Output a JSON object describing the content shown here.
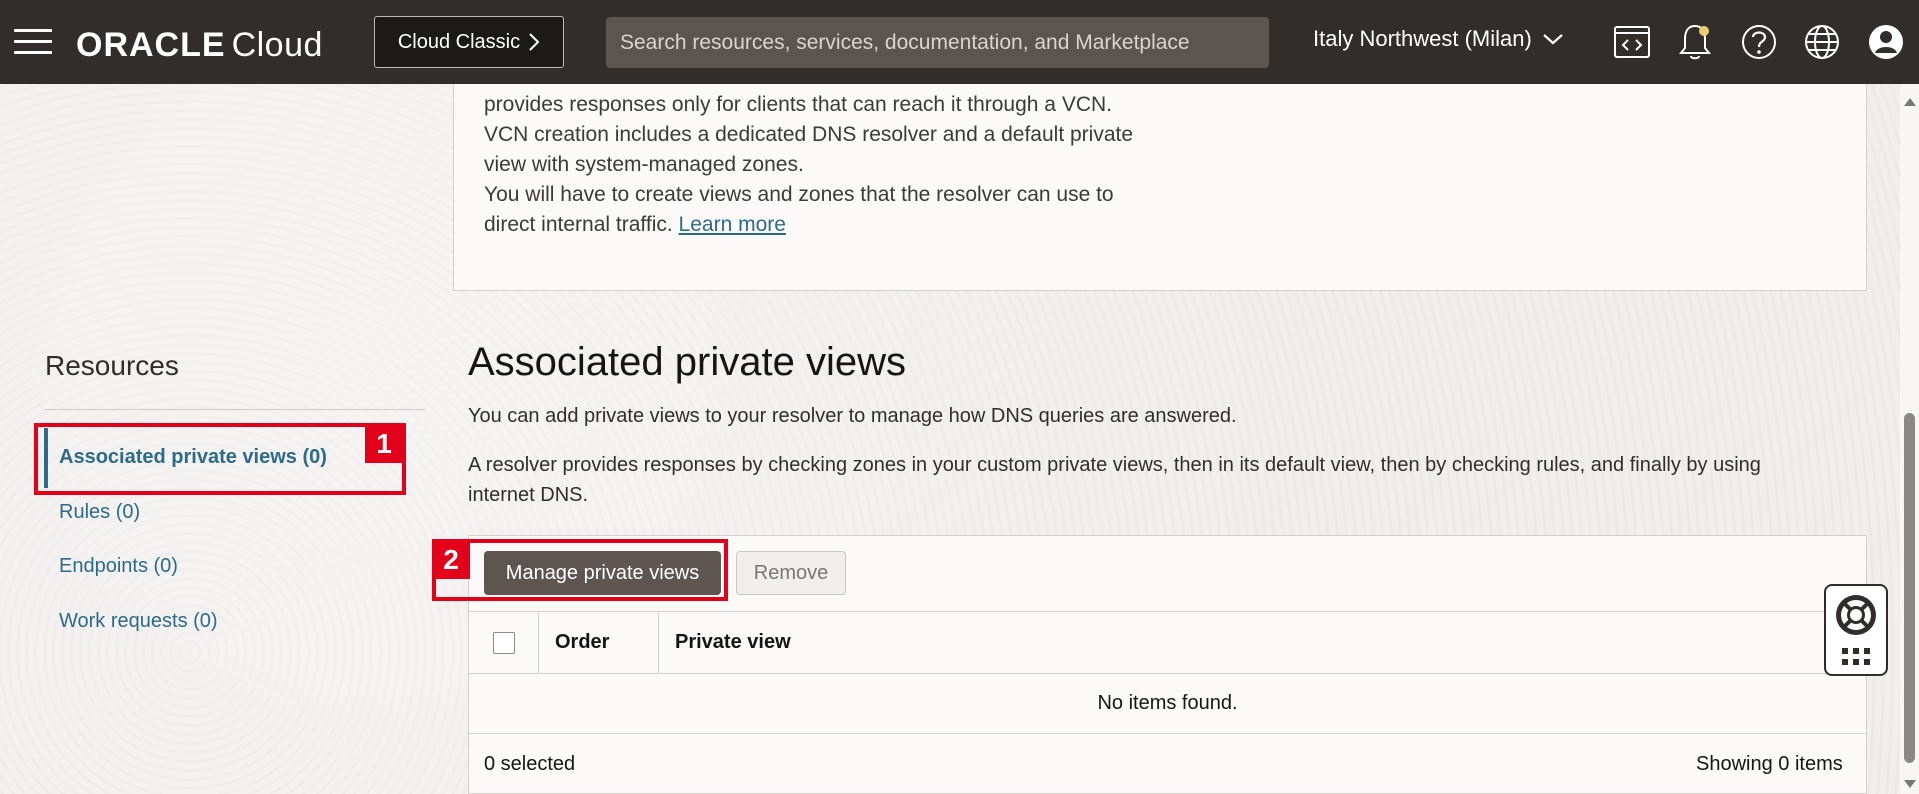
{
  "header": {
    "brand_oracle": "ORACLE",
    "brand_cloud": "Cloud",
    "classic_label": "Cloud Classic",
    "search_placeholder": "Search resources, services, documentation, and Marketplace",
    "region": "Italy Northwest (Milan)"
  },
  "info": {
    "line1": "provides responses only for clients that can reach it through a VCN.",
    "line2": "VCN creation includes a dedicated DNS resolver and a default private",
    "line3": "view with system-managed zones.",
    "line4": "You will have to create views and zones that the resolver can use to",
    "line5": "direct internal traffic.",
    "learn_more": "Learn more"
  },
  "resources": {
    "title": "Resources",
    "items": [
      {
        "label": "Associated private views (0)"
      },
      {
        "label": "Rules (0)"
      },
      {
        "label": "Endpoints (0)"
      },
      {
        "label": "Work requests (0)"
      }
    ]
  },
  "annotations": {
    "one": "1",
    "two": "2"
  },
  "main": {
    "title": "Associated private views",
    "desc1": "You can add private views to your resolver to manage how DNS queries are answered.",
    "desc2_line1": "A resolver provides responses by checking zones in your custom private views, then in its default view, then by checking rules, and finally by using",
    "desc2_line2": "internet DNS.",
    "manage_btn": "Manage private views",
    "remove_btn": "Remove",
    "columns": [
      "Order",
      "Private view"
    ],
    "empty": "No items found.",
    "selected": "0 selected",
    "showing": "Showing 0 items"
  },
  "colors": {
    "header_bg": "#312d2a",
    "link": "#2c6b8a",
    "annotation": "#e2001a",
    "primary_btn": "#5e5550"
  }
}
